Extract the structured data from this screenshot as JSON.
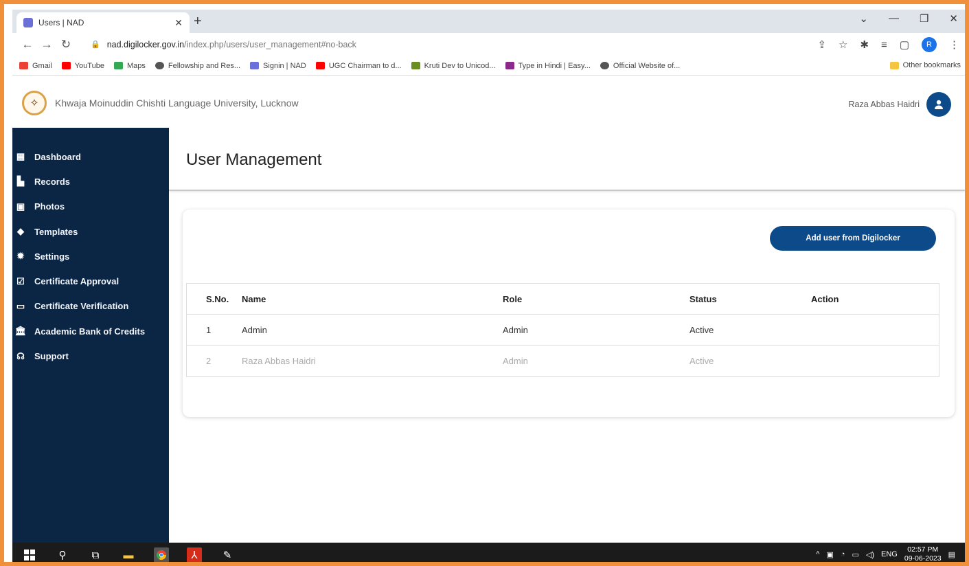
{
  "browser": {
    "tab_title": "Users | NAD",
    "address_host": "nad.digilocker.gov.in",
    "address_path": "/index.php/users/user_management#no-back",
    "bookmarks": [
      {
        "label": "Gmail",
        "color": "#ea4335"
      },
      {
        "label": "YouTube",
        "color": "#ff0000"
      },
      {
        "label": "Maps",
        "color": "#34a853"
      },
      {
        "label": "Fellowship and Res...",
        "color": "#555555"
      },
      {
        "label": "Signin | NAD",
        "color": "#6b6fd8"
      },
      {
        "label": "UGC Chairman to d...",
        "color": "#ff0000"
      },
      {
        "label": "Kruti Dev to Unicod...",
        "color": "#6b8e23"
      },
      {
        "label": "Type in Hindi | Easy...",
        "color": "#8b2a8b"
      },
      {
        "label": "Official Website of...",
        "color": "#555555"
      }
    ],
    "other_bookmarks": "Other bookmarks",
    "profile_initial": "R"
  },
  "header": {
    "university_name": "Khwaja Moinuddin Chishti Language University, Lucknow",
    "user_name": "Raza Abbas Haidri"
  },
  "sidebar": {
    "items": [
      {
        "label": "Dashboard",
        "icon": "calendar-icon"
      },
      {
        "label": "Records",
        "icon": "file-icon"
      },
      {
        "label": "Photos",
        "icon": "photo-icon"
      },
      {
        "label": "Templates",
        "icon": "tag-icon"
      },
      {
        "label": "Settings",
        "icon": "gear-icon"
      },
      {
        "label": "Certificate Approval",
        "icon": "approval-icon"
      },
      {
        "label": "Certificate Verification",
        "icon": "verification-icon"
      },
      {
        "label": "Academic Bank of Credits",
        "icon": "bank-icon"
      },
      {
        "label": "Support",
        "icon": "headset-icon"
      }
    ]
  },
  "main": {
    "page_title": "User Management",
    "add_button_label": "Add user from Digilocker",
    "table": {
      "headers": [
        "S.No.",
        "Name",
        "Role",
        "Status",
        "Action"
      ],
      "rows": [
        [
          "1",
          "Admin",
          "Admin",
          "Active",
          ""
        ],
        [
          "2",
          "Raza Abbas Haidri",
          "Admin",
          "Active",
          ""
        ]
      ]
    }
  },
  "taskbar": {
    "lang": "ENG",
    "time": "02:57 PM",
    "date": "09-06-2023"
  }
}
